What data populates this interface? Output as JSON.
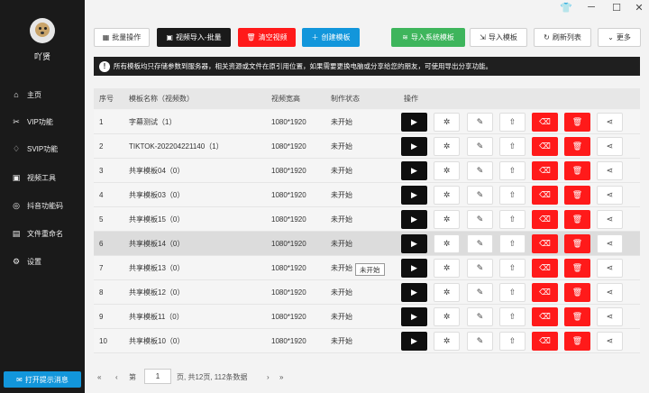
{
  "window": {
    "shirt_icon": "👕",
    "minimize": "─",
    "maximize": "☐",
    "close": "✕"
  },
  "sidebar": {
    "username": "吖贤",
    "items": [
      {
        "icon": "home-icon",
        "glyph": "⌂",
        "label": "主页"
      },
      {
        "icon": "scissors-icon",
        "glyph": "✂",
        "label": "VIP功能"
      },
      {
        "icon": "diamond-icon",
        "glyph": "♢",
        "label": "SVIP功能"
      },
      {
        "icon": "toolbox-icon",
        "glyph": "▣",
        "label": "视频工具"
      },
      {
        "icon": "location-icon",
        "glyph": "◎",
        "label": "抖音功能码"
      },
      {
        "icon": "file-icon",
        "glyph": "▤",
        "label": "文件重命名"
      },
      {
        "icon": "gear-icon",
        "glyph": "⚙",
        "label": "设置"
      }
    ],
    "tip_button": "打开提示消息"
  },
  "toolbar": {
    "batch": "批量操作",
    "import_video": "视频导入-批量",
    "clear_video": "清空视频",
    "create_template": "创建模板",
    "import_system": "导入系统模板",
    "import_template": "导入模板",
    "refresh": "刷新列表",
    "more": "更多"
  },
  "notice": "所有模板均只存储参数到服务器，相关资源或文件在原引用位置，如果需要更换电脑或分享给您的朋友，可使用导出分享功能。",
  "table": {
    "headers": {
      "no": "序号",
      "name": "模板名称（视频数）",
      "size": "视频宽高",
      "status": "制作状态",
      "ops": "操作"
    },
    "rows": [
      {
        "no": "1",
        "name": "字幕测试（1）",
        "size": "1080*1920",
        "status": "未开始"
      },
      {
        "no": "2",
        "name": "TIKTOK-202204221140（1）",
        "size": "1080*1920",
        "status": "未开始"
      },
      {
        "no": "3",
        "name": "共享模板04（0）",
        "size": "1080*1920",
        "status": "未开始"
      },
      {
        "no": "4",
        "name": "共享模板03（0）",
        "size": "1080*1920",
        "status": "未开始"
      },
      {
        "no": "5",
        "name": "共享模板15（0）",
        "size": "1080*1920",
        "status": "未开始"
      },
      {
        "no": "6",
        "name": "共享模板14（0）",
        "size": "1080*1920",
        "status": "未开始"
      },
      {
        "no": "7",
        "name": "共享模板13（0）",
        "size": "1080*1920",
        "status": "未开始"
      },
      {
        "no": "8",
        "name": "共享模板12（0）",
        "size": "1080*1920",
        "status": "未开始"
      },
      {
        "no": "9",
        "name": "共享模板11（0）",
        "size": "1080*1920",
        "status": "未开始"
      },
      {
        "no": "10",
        "name": "共享模板10（0）",
        "size": "1080*1920",
        "status": "未开始"
      }
    ]
  },
  "tooltip": "未开始",
  "pagination": {
    "first": "«",
    "prev": "‹",
    "page_prefix": "第",
    "page": "1",
    "page_suffix": "页, 共12页, 112条数据",
    "next": "›",
    "last": "»"
  }
}
